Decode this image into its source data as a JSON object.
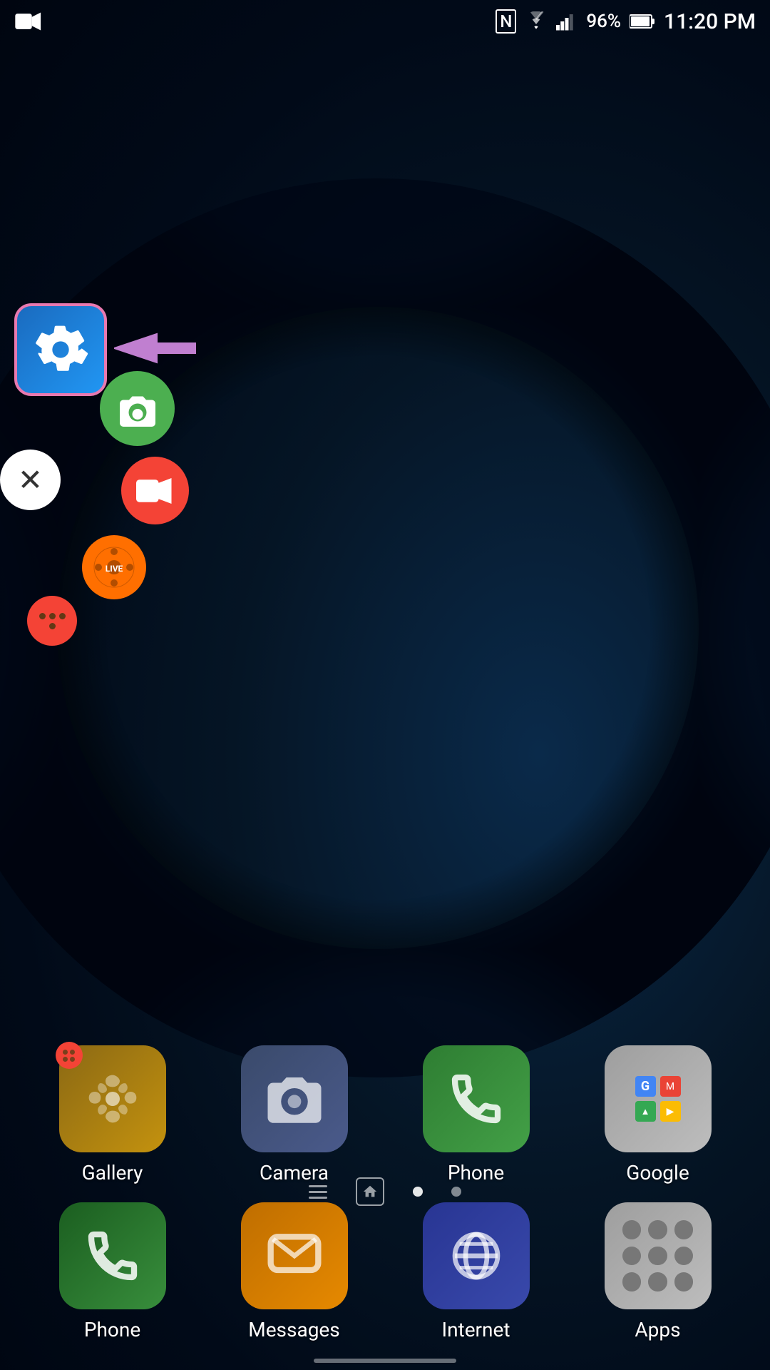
{
  "statusBar": {
    "time": "11:20 PM",
    "battery": "96%",
    "signal": "NFC+WiFi+LTE"
  },
  "floatingMenu": {
    "closeLabel": "✕",
    "liveLabel": "LIVE",
    "arrowDirection": "left"
  },
  "homeApps": [
    {
      "id": "gallery",
      "label": "Gallery",
      "iconClass": "icon-gallery"
    },
    {
      "id": "camera",
      "label": "Camera",
      "iconClass": "icon-camera"
    },
    {
      "id": "phone",
      "label": "Phone",
      "iconClass": "icon-phone-main"
    },
    {
      "id": "google",
      "label": "Google",
      "iconClass": "icon-google"
    }
  ],
  "dock": [
    {
      "id": "phone-dock",
      "label": "Phone",
      "iconClass": "icon-phone-dock"
    },
    {
      "id": "messages",
      "label": "Messages",
      "iconClass": "icon-messages"
    },
    {
      "id": "internet",
      "label": "Internet",
      "iconClass": "icon-internet"
    },
    {
      "id": "apps",
      "label": "Apps",
      "iconClass": "icon-apps"
    }
  ]
}
